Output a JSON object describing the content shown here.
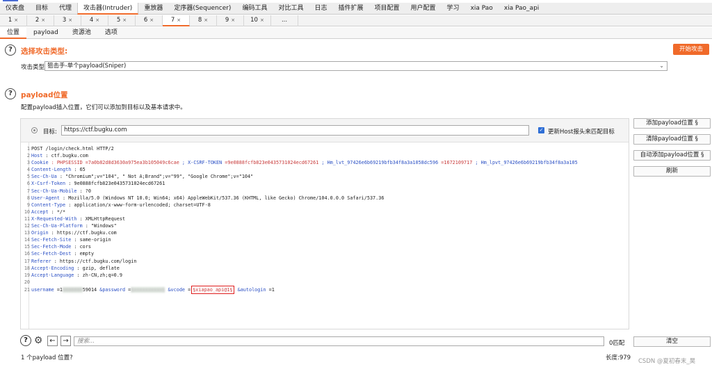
{
  "main_tabs": [
    "仪表盘",
    "目标",
    "代理",
    "攻击器(Intruder)",
    "重放器",
    "定序器(Sequencer)",
    "编码工具",
    "对比工具",
    "日志",
    "插件扩展",
    "项目配置",
    "用户配置",
    "学习",
    "xia Pao",
    "xia Pao_api"
  ],
  "main_tab_active": "攻击器(Intruder)",
  "sub_tabs": [
    {
      "label": "1",
      "close": "×"
    },
    {
      "label": "2",
      "close": "×"
    },
    {
      "label": "3",
      "close": "×"
    },
    {
      "label": "4",
      "close": "×"
    },
    {
      "label": "5",
      "close": "×"
    },
    {
      "label": "6",
      "close": "×"
    },
    {
      "label": "7",
      "close": "×"
    },
    {
      "label": "8",
      "close": "×"
    },
    {
      "label": "9",
      "close": "×"
    },
    {
      "label": "10",
      "close": "×"
    },
    {
      "label": "...",
      "close": ""
    }
  ],
  "sub_tab_active": "7",
  "inner_tabs": [
    "位置",
    "payload",
    "资源池",
    "选项"
  ],
  "inner_tab_active": "位置",
  "attack": {
    "title": "选择攻击类型:",
    "start_button": "开始攻击",
    "type_label": "攻击类型:",
    "type_value": "狙击手-单个payload(Sniper)"
  },
  "positions": {
    "title": "payload位置",
    "description": "配置payload插入位置，它们可以添加到目标以及基本请求中。",
    "target_label": "目标:",
    "target_value": "https://ctf.bugku.com",
    "host_checkbox_label": "更新Host报头来匹配目标"
  },
  "side_buttons": {
    "add": "添加payload位置 §",
    "clear": "清除payload位置 §",
    "auto": "自动添加payload位置 §",
    "refresh": "刷新"
  },
  "request": {
    "l1": "POST  /login/check.html   HTTP/2",
    "l2k": "Host",
    "l2v": " : ctf.bugku.com",
    "l3k": "Cookie",
    "l3v": " : PHPSESSID =7a0b82d8d3630a975ea3b105049c6cae",
    "l3k2": "  ;  X-CSRF-TOKEN ",
    "l3v2": "=9e0888fcfb823e0435731024ecd67261",
    "l3k3": "  ;  Hm_lvt_97426e6b69219bfb34f8a3a1058dc596",
    "l3v3": "  =1672109717",
    "l3k4": " ;  Hm_lpvt_97426e6b69219bfb34f8a3a105",
    "l4k": "Content-Length",
    "l4v": " : 65",
    "l5k": "Sec-Ch-Ua",
    "l5v": " : \"Chromium\";v=\"104\",    \" Not A;Brand\";v=\"99\",    \"Google  Chrome\";v=\"104\"",
    "l6k": "X-Csrf-Token",
    "l6v": " : 9e0888fcfb823e0435731024ecd67261",
    "l7k": "Sec-Ch-Ua-Mobile",
    "l7v": " : ?0",
    "l8k": "User-Agent",
    "l8v": " : Mozilla/5.0  (Windows  NT 10.0;  Win64;  x64) AppleWebKit/537.36   (KHTML,  like Gecko) Chrome/104.0.0.0   Safari/537.36",
    "l9k": "Content-Type",
    "l9v": " : application/x-www-form-urlencoded;     charset=UTF-8",
    "l10k": "Accept",
    "l10v": " : */*",
    "l11k": "X-Requested-With",
    "l11v": " : XMLHttpRequest",
    "l12k": "Sec-Ch-Ua-Platform",
    "l12v": " : \"Windows\"",
    "l13k": "Origin",
    "l13v": " : https://ctf.bugku.com",
    "l14k": "Sec-Fetch-Site",
    "l14v": " : same-origin",
    "l15k": "Sec-Fetch-Mode",
    "l15v": " : cors",
    "l16k": "Sec-Fetch-Dest",
    "l16v": " : empty",
    "l17k": "Referer",
    "l17v": " : https://ctf.bugku.com/login",
    "l18k": "Accept-Encoding",
    "l18v": " : gzip,  deflate",
    "l19k": "Accept-Language",
    "l19v": " : zh-CN,zh;q=0.9",
    "l21k1": "username",
    "l21v1": " =1",
    "l21blur1": "8888888",
    "l21v1b": "59014",
    "l21k2": " &password",
    "l21v2": " =",
    "l21blur2": "§xxxxxxxxxx§",
    "l21k3": " &vcode",
    "l21v3": " =",
    "l21hl": "§xiapao_api@1§",
    "l21k4": " &autologin",
    "l21v4": " =1"
  },
  "bottom": {
    "search_placeholder": "搜索...",
    "match_count": "0匹配",
    "clear_button": "清空"
  },
  "status": {
    "positions_count": "1 个payload 位置?",
    "length": "长度:979"
  },
  "watermark": "CSDN @夏初春末_昊"
}
